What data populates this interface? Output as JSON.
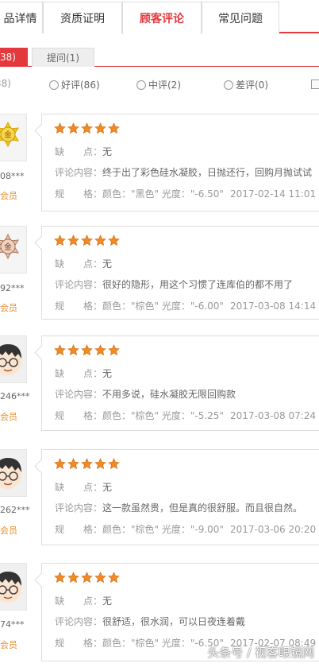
{
  "tabs": [
    "品详情",
    "资质证明",
    "顾客评论",
    "常见问题"
  ],
  "subtabs": {
    "reviews_count": "38)",
    "questions": "提问(1)"
  },
  "filters": {
    "all": "38)",
    "good": "好评(86)",
    "medium": "中评(2)",
    "bad": "差评(0)"
  },
  "field_labels": {
    "cons": "缺　　点：",
    "content": "评论内容：",
    "spec": "规　　格："
  },
  "reviews": [
    {
      "user": "08***",
      "level": "会员",
      "badge": "金",
      "rating": 5,
      "cons": "无",
      "content": "终于出了彩色硅水凝胶，日抛还行，回购月抛试试",
      "spec": "颜色：\"黑色\"  光度：\"-6.50\"",
      "date": "2017-02-14 11:01"
    },
    {
      "user": "92***",
      "level": "会员",
      "badge": "金",
      "rating": 5,
      "cons": "无",
      "content": "很好的隐形，用这个习惯了连库伯的都不用了",
      "spec": "颜色：\"棕色\"  光度：\"-6.00\"",
      "date": "2017-03-08 14:14"
    },
    {
      "user": "246***",
      "level": "会员",
      "badge": "",
      "rating": 5,
      "cons": "无",
      "content": "不用多说，硅水凝胶无限回购款",
      "spec": "颜色：\"棕色\"  光度：\"-5.25\"",
      "date": "2017-03-08 07:24"
    },
    {
      "user": "262***",
      "level": "会员",
      "badge": "",
      "rating": 5,
      "cons": "无",
      "content": "这一款虽然贵，但是真的很舒服。而且很自然。",
      "spec": "颜色：\"棕色\"  光度：\"-9.00\"",
      "date": "2017-03-06 20:20"
    },
    {
      "user": "74***",
      "level": "会员",
      "badge": "",
      "rating": 5,
      "cons": "无",
      "content": "很舒适，很水润，可以日夜连着戴",
      "spec": "颜色：\"棕色\"  光度：\"-6.50\"",
      "date": "2017-02-07 08:49"
    }
  ],
  "watermark": "头条号 / 视客眼镜网",
  "colors": {
    "accent": "#e4393c",
    "star": "#f08a24",
    "level": "#e8912e"
  }
}
